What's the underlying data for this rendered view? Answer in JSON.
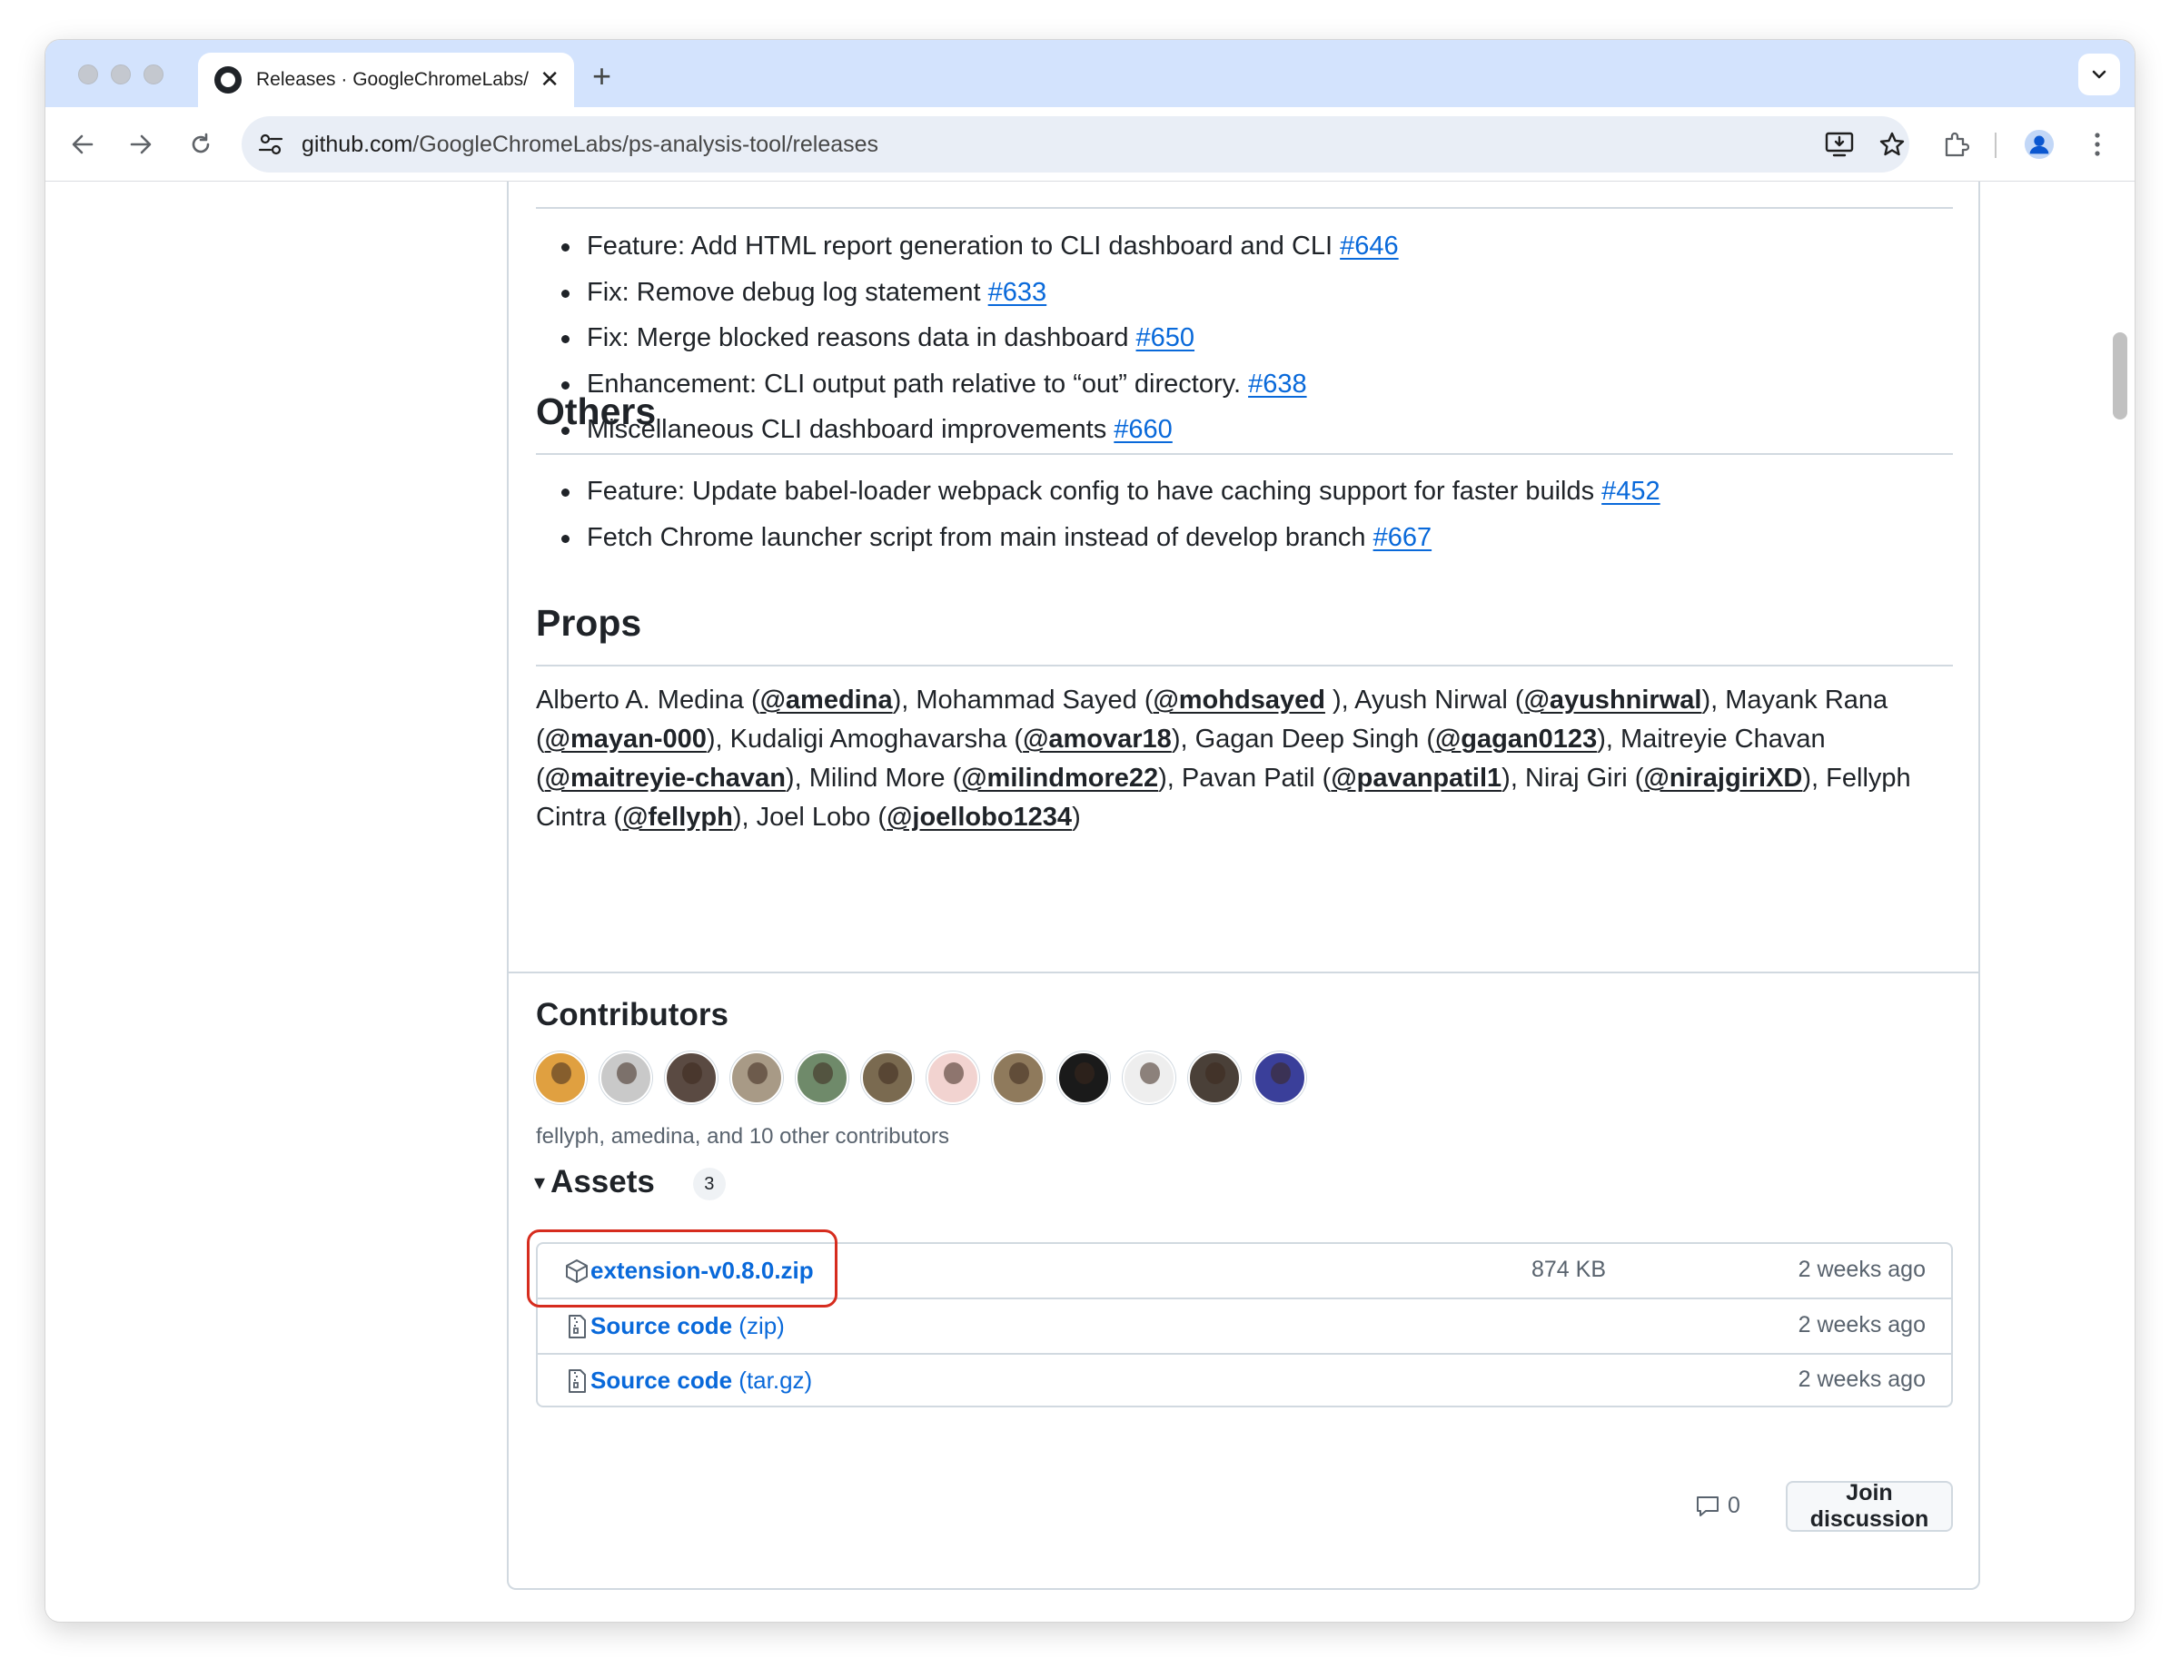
{
  "browser": {
    "tab_title": "Releases · GoogleChromeLabs/ps-analysis-tool",
    "close_glyph": "✕",
    "new_tab_glyph": "+",
    "url_host": "github.com",
    "url_path": "/GoogleChromeLabs/ps-analysis-tool/releases"
  },
  "content": {
    "cli_items": [
      {
        "text": "Feature: Add HTML report generation to CLI dashboard and CLI ",
        "link": "#646"
      },
      {
        "text": "Fix: Remove debug log statement ",
        "link": "#633"
      },
      {
        "text": "Fix: Merge blocked reasons data in dashboard ",
        "link": "#650"
      },
      {
        "text": "Enhancement: CLI output path relative to “out” directory. ",
        "link": "#638"
      },
      {
        "text": "Miscellaneous CLI dashboard improvements ",
        "link": "#660"
      }
    ],
    "others_title": "Others",
    "others_items": [
      {
        "text": "Feature: Update babel-loader webpack config to have caching support for faster builds ",
        "link": "#452"
      },
      {
        "text": "Fetch Chrome launcher script from main instead of develop branch ",
        "link": "#667"
      }
    ],
    "props_title": "Props",
    "props": [
      {
        "name": "Alberto A. Medina (",
        "handle": "@amedina",
        "after": "), "
      },
      {
        "name": "Mohammad Sayed (",
        "handle": "@mohdsayed",
        "after": " ), "
      },
      {
        "name": "Ayush Nirwal (",
        "handle": "@ayushnirwal",
        "after": "), "
      },
      {
        "name": "Mayank Rana (",
        "handle": "@mayan-000",
        "after": "), "
      },
      {
        "name": "Kudaligi Amoghavarsha (",
        "handle": "@amovar18",
        "after": "), "
      },
      {
        "name": "Gagan Deep Singh (",
        "handle": "@gagan0123",
        "after": "), "
      },
      {
        "name": "Maitreyie Chavan (",
        "handle": "@maitreyie-chavan",
        "after": "), "
      },
      {
        "name": "Milind More (",
        "handle": "@milindmore22",
        "after": "), "
      },
      {
        "name": "Pavan Patil (",
        "handle": "@pavanpatil1",
        "after": "), "
      },
      {
        "name": "Niraj Giri (",
        "handle": "@nirajgiriXD",
        "after": "), "
      },
      {
        "name": "Fellyph Cintra (",
        "handle": "@fellyph",
        "after": "), "
      },
      {
        "name": "Joel Lobo (",
        "handle": "@joellobo1234",
        "after": ")"
      }
    ]
  },
  "contributors": {
    "title": "Contributors",
    "avatar_colors": [
      "#e0a040",
      "#c9c9c9",
      "#5a4a42",
      "#a89a86",
      "#6f8a6a",
      "#7a6a50",
      "#f2d3d0",
      "#8f7a5c",
      "#1a1a1a",
      "#eeeeee",
      "#4a4038",
      "#3a3f9a"
    ],
    "note": "fellyph, amedina, and 10 other contributors"
  },
  "assets": {
    "caret": "▾",
    "title": "Assets",
    "count": "3",
    "rows": [
      {
        "name": "extension-v0.8.0.zip",
        "sub": "",
        "size": "874 KB",
        "date": "2 weeks ago",
        "icon": "package-icon"
      },
      {
        "name": "Source code",
        "sub": " (zip)",
        "size": "",
        "date": "2 weeks ago",
        "icon": "file-zip-icon"
      },
      {
        "name": "Source code",
        "sub": " (tar.gz)",
        "size": "",
        "date": "2 weeks ago",
        "icon": "file-zip-icon"
      }
    ]
  },
  "discussion": {
    "comment_count": "0",
    "button_label": "Join discussion"
  },
  "colors": {
    "link": "#0969da",
    "highlight": "#d62c1e",
    "tabstrip": "#d3e3fd"
  }
}
